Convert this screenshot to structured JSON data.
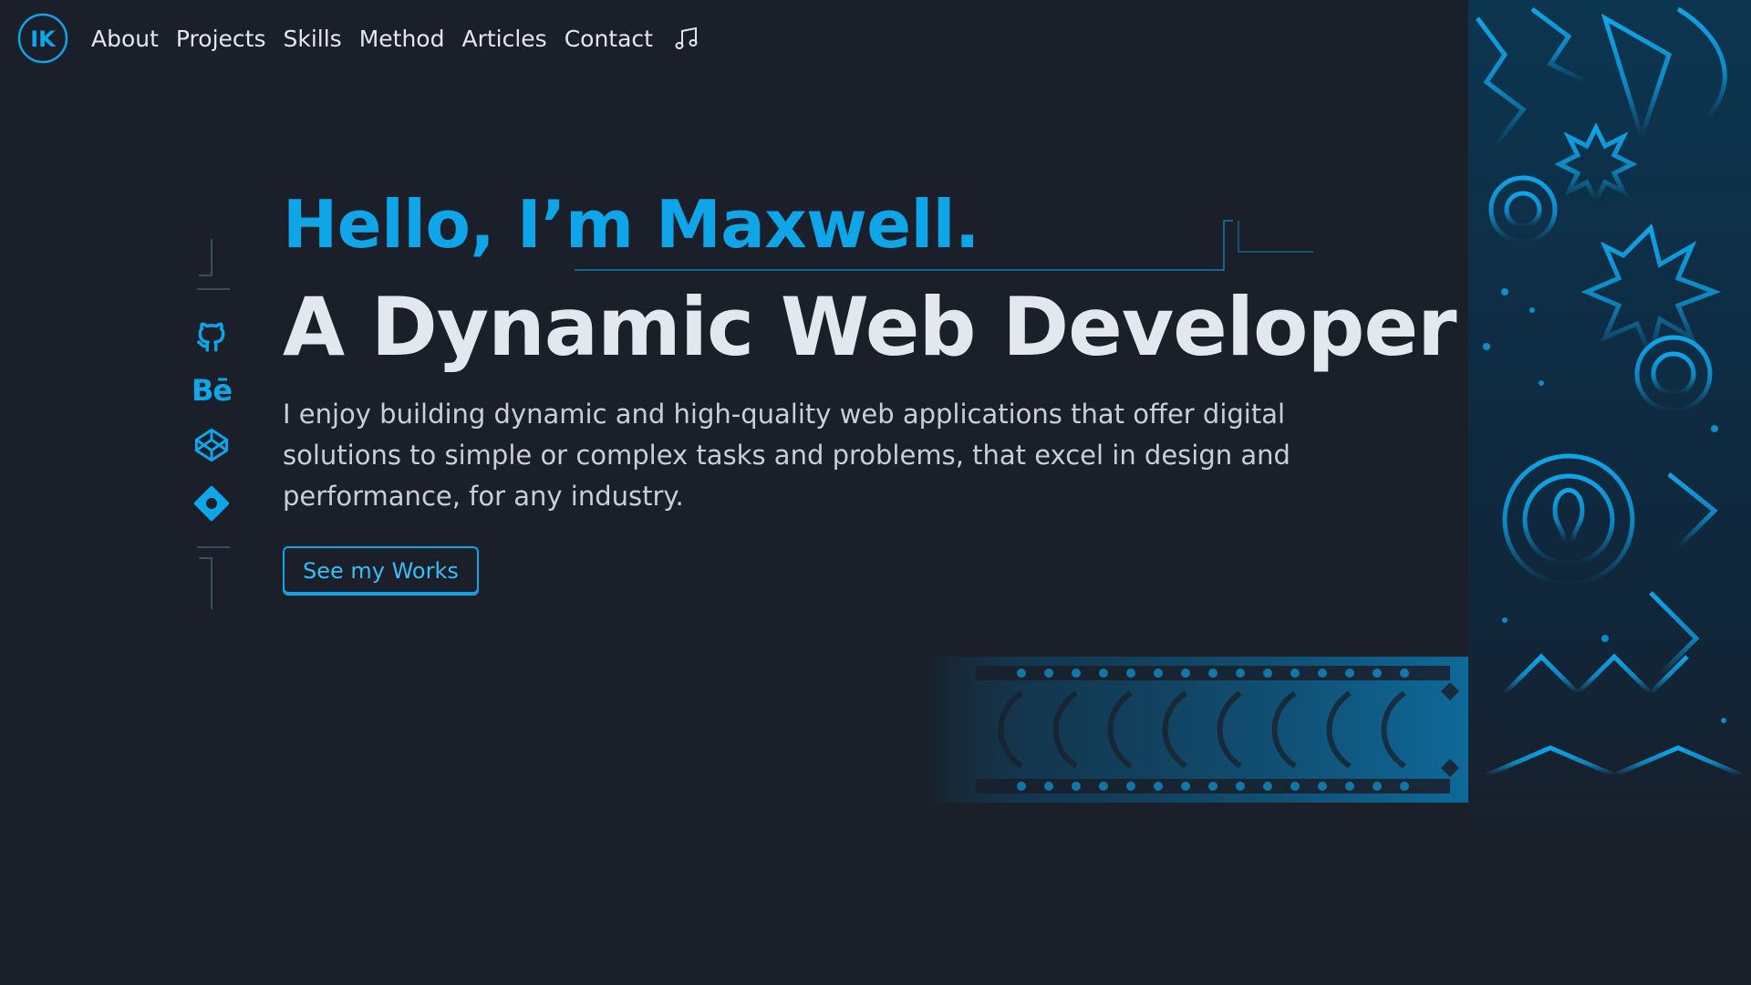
{
  "nav": {
    "logo_text": "IK",
    "links": [
      {
        "label": "About"
      },
      {
        "label": "Projects"
      },
      {
        "label": "Skills"
      },
      {
        "label": "Method"
      },
      {
        "label": "Articles"
      },
      {
        "label": "Contact"
      }
    ],
    "music_icon": "music-note-icon"
  },
  "social": {
    "icons": [
      "github-icon",
      "behance-icon",
      "codepen-icon",
      "bestmotion-icon"
    ],
    "behance_text": "Bē"
  },
  "hero": {
    "greeting": "Hello, I’m Maxwell.",
    "role": "A Dynamic Web Developer",
    "intro": "I enjoy building dynamic and high-quality web applications that offer digital solutions to simple or complex tasks and problems, that excel in design and performance, for any industry.",
    "cta_label": "See my Works"
  },
  "colors": {
    "background": "#1a1f29",
    "accent": "#0ea5e9",
    "text": "#e3e7ee",
    "muted_text": "#c9ced8"
  }
}
